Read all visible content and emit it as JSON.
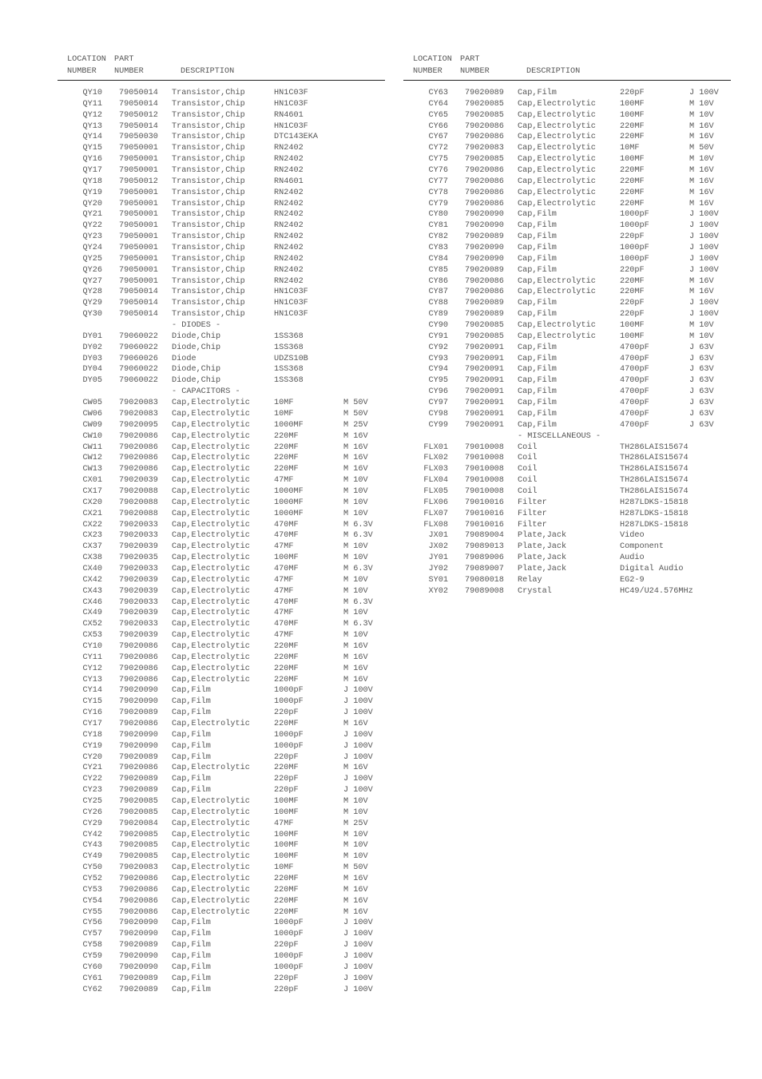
{
  "header": {
    "line1": [
      "LOCATION",
      "PART"
    ],
    "line2": [
      "NUMBER",
      "NUMBER",
      "DESCRIPTION"
    ]
  },
  "left_column": [
    {
      "loc": "QY10",
      "part": "79050014",
      "desc": "Transistor,Chip",
      "value": "HN1C03F",
      "rating": ""
    },
    {
      "loc": "QY11",
      "part": "79050014",
      "desc": "Transistor,Chip",
      "value": "HN1C03F",
      "rating": ""
    },
    {
      "loc": "QY12",
      "part": "79050012",
      "desc": "Transistor,Chip",
      "value": "RN4601",
      "rating": ""
    },
    {
      "loc": "QY13",
      "part": "79050014",
      "desc": "Transistor,Chip",
      "value": "HN1C03F",
      "rating": ""
    },
    {
      "loc": "QY14",
      "part": "79050030",
      "desc": "Transistor,Chip",
      "value": "DTC143EKA",
      "rating": ""
    },
    {
      "loc": "QY15",
      "part": "79050001",
      "desc": "Transistor,Chip",
      "value": "RN2402",
      "rating": ""
    },
    {
      "loc": "QY16",
      "part": "79050001",
      "desc": "Transistor,Chip",
      "value": "RN2402",
      "rating": ""
    },
    {
      "loc": "QY17",
      "part": "79050001",
      "desc": "Transistor,Chip",
      "value": "RN2402",
      "rating": ""
    },
    {
      "loc": "QY18",
      "part": "79050012",
      "desc": "Transistor,Chip",
      "value": "RN4601",
      "rating": ""
    },
    {
      "loc": "QY19",
      "part": "79050001",
      "desc": "Transistor,Chip",
      "value": "RN2402",
      "rating": ""
    },
    {
      "loc": "QY20",
      "part": "79050001",
      "desc": "Transistor,Chip",
      "value": "RN2402",
      "rating": ""
    },
    {
      "loc": "QY21",
      "part": "79050001",
      "desc": "Transistor,Chip",
      "value": "RN2402",
      "rating": ""
    },
    {
      "loc": "QY22",
      "part": "79050001",
      "desc": "Transistor,Chip",
      "value": "RN2402",
      "rating": ""
    },
    {
      "loc": "QY23",
      "part": "79050001",
      "desc": "Transistor,Chip",
      "value": "RN2402",
      "rating": ""
    },
    {
      "loc": "QY24",
      "part": "79050001",
      "desc": "Transistor,Chip",
      "value": "RN2402",
      "rating": ""
    },
    {
      "loc": "QY25",
      "part": "79050001",
      "desc": "Transistor,Chip",
      "value": "RN2402",
      "rating": ""
    },
    {
      "loc": "QY26",
      "part": "79050001",
      "desc": "Transistor,Chip",
      "value": "RN2402",
      "rating": ""
    },
    {
      "loc": "QY27",
      "part": "79050001",
      "desc": "Transistor,Chip",
      "value": "RN2402",
      "rating": ""
    },
    {
      "loc": "QY28",
      "part": "79050014",
      "desc": "Transistor,Chip",
      "value": "HN1C03F",
      "rating": ""
    },
    {
      "loc": "QY29",
      "part": "79050014",
      "desc": "Transistor,Chip",
      "value": "HN1C03F",
      "rating": ""
    },
    {
      "loc": "QY30",
      "part": "79050014",
      "desc": "Transistor,Chip",
      "value": "HN1C03F",
      "rating": ""
    },
    {
      "section": "- DIODES -"
    },
    {
      "loc": "DY01",
      "part": "79060022",
      "desc": "Diode,Chip",
      "value": "1SS368",
      "rating": ""
    },
    {
      "loc": "DY02",
      "part": "79060022",
      "desc": "Diode,Chip",
      "value": "1SS368",
      "rating": ""
    },
    {
      "loc": "DY03",
      "part": "79060026",
      "desc": "Diode",
      "value": "UDZS10B",
      "rating": ""
    },
    {
      "loc": "DY04",
      "part": "79060022",
      "desc": "Diode,Chip",
      "value": "1SS368",
      "rating": ""
    },
    {
      "loc": "DY05",
      "part": "79060022",
      "desc": "Diode,Chip",
      "value": "1SS368",
      "rating": ""
    },
    {
      "section": "- CAPACITORS -"
    },
    {
      "loc": "CW05",
      "part": "79020083",
      "desc": "Cap,Electrolytic",
      "value": "10MF",
      "rating": "M 50V"
    },
    {
      "loc": "CW06",
      "part": "79020083",
      "desc": "Cap,Electrolytic",
      "value": "10MF",
      "rating": "M 50V"
    },
    {
      "loc": "CW09",
      "part": "79020095",
      "desc": "Cap,Electrolytic",
      "value": "1000MF",
      "rating": "M 25V"
    },
    {
      "loc": "CW10",
      "part": "79020086",
      "desc": "Cap,Electrolytic",
      "value": "220MF",
      "rating": "M 16V"
    },
    {
      "loc": "CW11",
      "part": "79020086",
      "desc": "Cap,Electrolytic",
      "value": "220MF",
      "rating": "M 16V"
    },
    {
      "loc": "CW12",
      "part": "79020086",
      "desc": "Cap,Electrolytic",
      "value": "220MF",
      "rating": "M 16V"
    },
    {
      "loc": "CW13",
      "part": "79020086",
      "desc": "Cap,Electrolytic",
      "value": "220MF",
      "rating": "M 16V"
    },
    {
      "loc": "CX01",
      "part": "79020039",
      "desc": "Cap,Electrolytic",
      "value": "47MF",
      "rating": "M 10V"
    },
    {
      "loc": "CX17",
      "part": "79020088",
      "desc": "Cap,Electrolytic",
      "value": "1000MF",
      "rating": "M 10V"
    },
    {
      "loc": "CX20",
      "part": "79020088",
      "desc": "Cap,Electrolytic",
      "value": "1000MF",
      "rating": "M 10V"
    },
    {
      "loc": "CX21",
      "part": "79020088",
      "desc": "Cap,Electrolytic",
      "value": "1000MF",
      "rating": "M 10V"
    },
    {
      "loc": "CX22",
      "part": "79020033",
      "desc": "Cap,Electrolytic",
      "value": "470MF",
      "rating": "M 6.3V"
    },
    {
      "loc": "CX23",
      "part": "79020033",
      "desc": "Cap,Electrolytic",
      "value": "470MF",
      "rating": "M 6.3V"
    },
    {
      "loc": "CX37",
      "part": "79020039",
      "desc": "Cap,Electrolytic",
      "value": "47MF",
      "rating": "M 10V"
    },
    {
      "loc": "CX38",
      "part": "79020035",
      "desc": "Cap,Electrolytic",
      "value": "100MF",
      "rating": "M 10V"
    },
    {
      "loc": "CX40",
      "part": "79020033",
      "desc": "Cap,Electrolytic",
      "value": "470MF",
      "rating": "M 6.3V"
    },
    {
      "loc": "CX42",
      "part": "79020039",
      "desc": "Cap,Electrolytic",
      "value": "47MF",
      "rating": "M 10V"
    },
    {
      "loc": "CX43",
      "part": "79020039",
      "desc": "Cap,Electrolytic",
      "value": "47MF",
      "rating": "M 10V"
    },
    {
      "loc": "CX46",
      "part": "79020033",
      "desc": "Cap,Electrolytic",
      "value": "470MF",
      "rating": "M 6.3V"
    },
    {
      "loc": "CX49",
      "part": "79020039",
      "desc": "Cap,Electrolytic",
      "value": "47MF",
      "rating": "M 10V"
    },
    {
      "loc": "CX52",
      "part": "79020033",
      "desc": "Cap,Electrolytic",
      "value": "470MF",
      "rating": "M 6.3V"
    },
    {
      "loc": "CX53",
      "part": "79020039",
      "desc": "Cap,Electrolytic",
      "value": "47MF",
      "rating": "M 10V"
    },
    {
      "loc": "CY10",
      "part": "79020086",
      "desc": "Cap,Electrolytic",
      "value": "220MF",
      "rating": "M 16V"
    },
    {
      "loc": "CY11",
      "part": "79020086",
      "desc": "Cap,Electrolytic",
      "value": "220MF",
      "rating": "M 16V"
    },
    {
      "loc": "CY12",
      "part": "79020086",
      "desc": "Cap,Electrolytic",
      "value": "220MF",
      "rating": "M 16V"
    },
    {
      "loc": "CY13",
      "part": "79020086",
      "desc": "Cap,Electrolytic",
      "value": "220MF",
      "rating": "M 16V"
    },
    {
      "loc": "CY14",
      "part": "79020090",
      "desc": "Cap,Film",
      "value": "1000pF",
      "rating": "J 100V"
    },
    {
      "loc": "CY15",
      "part": "79020090",
      "desc": "Cap,Film",
      "value": "1000pF",
      "rating": "J 100V"
    },
    {
      "loc": "CY16",
      "part": "79020089",
      "desc": "Cap,Film",
      "value": "220pF",
      "rating": "J 100V"
    },
    {
      "loc": "CY17",
      "part": "79020086",
      "desc": "Cap,Electrolytic",
      "value": "220MF",
      "rating": "M 16V"
    },
    {
      "loc": "CY18",
      "part": "79020090",
      "desc": "Cap,Film",
      "value": "1000pF",
      "rating": "J 100V"
    },
    {
      "loc": "CY19",
      "part": "79020090",
      "desc": "Cap,Film",
      "value": "1000pF",
      "rating": "J 100V"
    },
    {
      "loc": "CY20",
      "part": "79020089",
      "desc": "Cap,Film",
      "value": "220pF",
      "rating": "J 100V"
    },
    {
      "loc": "CY21",
      "part": "79020086",
      "desc": "Cap,Electrolytic",
      "value": "220MF",
      "rating": "M 16V"
    },
    {
      "loc": "CY22",
      "part": "79020089",
      "desc": "Cap,Film",
      "value": "220pF",
      "rating": "J 100V"
    },
    {
      "loc": "CY23",
      "part": "79020089",
      "desc": "Cap,Film",
      "value": "220pF",
      "rating": "J 100V"
    },
    {
      "loc": "CY25",
      "part": "79020085",
      "desc": "Cap,Electrolytic",
      "value": "100MF",
      "rating": "M 10V"
    },
    {
      "loc": "CY26",
      "part": "79020085",
      "desc": "Cap,Electrolytic",
      "value": "100MF",
      "rating": "M 10V"
    },
    {
      "loc": "CY29",
      "part": "79020084",
      "desc": "Cap,Electrolytic",
      "value": "47MF",
      "rating": "M 25V"
    },
    {
      "loc": "CY42",
      "part": "79020085",
      "desc": "Cap,Electrolytic",
      "value": "100MF",
      "rating": "M 10V"
    },
    {
      "loc": "CY43",
      "part": "79020085",
      "desc": "Cap,Electrolytic",
      "value": "100MF",
      "rating": "M 10V"
    },
    {
      "loc": "CY49",
      "part": "79020085",
      "desc": "Cap,Electrolytic",
      "value": "100MF",
      "rating": "M 10V"
    },
    {
      "loc": "CY50",
      "part": "79020083",
      "desc": "Cap,Electrolytic",
      "value": "10MF",
      "rating": "M 50V"
    },
    {
      "loc": "CY52",
      "part": "79020086",
      "desc": "Cap,Electrolytic",
      "value": "220MF",
      "rating": "M 16V"
    },
    {
      "loc": "CY53",
      "part": "79020086",
      "desc": "Cap,Electrolytic",
      "value": "220MF",
      "rating": "M 16V"
    },
    {
      "loc": "CY54",
      "part": "79020086",
      "desc": "Cap,Electrolytic",
      "value": "220MF",
      "rating": "M 16V"
    },
    {
      "loc": "CY55",
      "part": "79020086",
      "desc": "Cap,Electrolytic",
      "value": "220MF",
      "rating": "M 16V"
    },
    {
      "loc": "CY56",
      "part": "79020090",
      "desc": "Cap,Film",
      "value": "1000pF",
      "rating": "J 100V"
    },
    {
      "loc": "CY57",
      "part": "79020090",
      "desc": "Cap,Film",
      "value": "1000pF",
      "rating": "J 100V"
    },
    {
      "loc": "CY58",
      "part": "79020089",
      "desc": "Cap,Film",
      "value": "220pF",
      "rating": "J 100V"
    },
    {
      "loc": "CY59",
      "part": "79020090",
      "desc": "Cap,Film",
      "value": "1000pF",
      "rating": "J 100V"
    },
    {
      "loc": "CY60",
      "part": "79020090",
      "desc": "Cap,Film",
      "value": "1000pF",
      "rating": "J 100V"
    },
    {
      "loc": "CY61",
      "part": "79020089",
      "desc": "Cap,Film",
      "value": "220pF",
      "rating": "J 100V"
    },
    {
      "loc": "CY62",
      "part": "79020089",
      "desc": "Cap,Film",
      "value": "220pF",
      "rating": "J 100V"
    }
  ],
  "right_column": [
    {
      "loc": "CY63",
      "part": "79020089",
      "desc": "Cap,Film",
      "value": "220pF",
      "rating": "J 100V"
    },
    {
      "loc": "CY64",
      "part": "79020085",
      "desc": "Cap,Electrolytic",
      "value": "100MF",
      "rating": "M 10V"
    },
    {
      "loc": "CY65",
      "part": "79020085",
      "desc": "Cap,Electrolytic",
      "value": "100MF",
      "rating": "M 10V"
    },
    {
      "loc": "CY66",
      "part": "79020086",
      "desc": "Cap,Electrolytic",
      "value": "220MF",
      "rating": "M 16V"
    },
    {
      "loc": "CY67",
      "part": "79020086",
      "desc": "Cap,Electrolytic",
      "value": "220MF",
      "rating": "M 16V"
    },
    {
      "loc": "CY72",
      "part": "79020083",
      "desc": "Cap,Electrolytic",
      "value": "10MF",
      "rating": "M 50V"
    },
    {
      "loc": "CY75",
      "part": "79020085",
      "desc": "Cap,Electrolytic",
      "value": "100MF",
      "rating": "M 10V"
    },
    {
      "loc": "CY76",
      "part": "79020086",
      "desc": "Cap,Electrolytic",
      "value": "220MF",
      "rating": "M 16V"
    },
    {
      "loc": "CY77",
      "part": "79020086",
      "desc": "Cap,Electrolytic",
      "value": "220MF",
      "rating": "M 16V"
    },
    {
      "loc": "CY78",
      "part": "79020086",
      "desc": "Cap,Electrolytic",
      "value": "220MF",
      "rating": "M 16V"
    },
    {
      "loc": "CY79",
      "part": "79020086",
      "desc": "Cap,Electrolytic",
      "value": "220MF",
      "rating": "M 16V"
    },
    {
      "loc": "CY80",
      "part": "79020090",
      "desc": "Cap,Film",
      "value": "1000pF",
      "rating": "J 100V"
    },
    {
      "loc": "CY81",
      "part": "79020090",
      "desc": "Cap,Film",
      "value": "1000pF",
      "rating": "J 100V"
    },
    {
      "loc": "CY82",
      "part": "79020089",
      "desc": "Cap,Film",
      "value": "220pF",
      "rating": "J 100V"
    },
    {
      "loc": "CY83",
      "part": "79020090",
      "desc": "Cap,Film",
      "value": "1000pF",
      "rating": "J 100V"
    },
    {
      "loc": "CY84",
      "part": "79020090",
      "desc": "Cap,Film",
      "value": "1000pF",
      "rating": "J 100V"
    },
    {
      "loc": "CY85",
      "part": "79020089",
      "desc": "Cap,Film",
      "value": "220pF",
      "rating": "J 100V"
    },
    {
      "loc": "CY86",
      "part": "79020086",
      "desc": "Cap,Electrolytic",
      "value": "220MF",
      "rating": "M 16V"
    },
    {
      "loc": "CY87",
      "part": "79020086",
      "desc": "Cap,Electrolytic",
      "value": "220MF",
      "rating": "M 16V"
    },
    {
      "loc": "CY88",
      "part": "79020089",
      "desc": "Cap,Film",
      "value": "220pF",
      "rating": "J 100V"
    },
    {
      "loc": "CY89",
      "part": "79020089",
      "desc": "Cap,Film",
      "value": "220pF",
      "rating": "J 100V"
    },
    {
      "loc": "CY90",
      "part": "79020085",
      "desc": "Cap,Electrolytic",
      "value": "100MF",
      "rating": "M 10V"
    },
    {
      "loc": "CY91",
      "part": "79020085",
      "desc": "Cap,Electrolytic",
      "value": "100MF",
      "rating": "M 10V"
    },
    {
      "loc": "CY92",
      "part": "79020091",
      "desc": "Cap,Film",
      "value": "4700pF",
      "rating": "J 63V"
    },
    {
      "loc": "CY93",
      "part": "79020091",
      "desc": "Cap,Film",
      "value": "4700pF",
      "rating": "J 63V"
    },
    {
      "loc": "CY94",
      "part": "79020091",
      "desc": "Cap,Film",
      "value": "4700pF",
      "rating": "J 63V"
    },
    {
      "loc": "CY95",
      "part": "79020091",
      "desc": "Cap,Film",
      "value": "4700pF",
      "rating": "J 63V"
    },
    {
      "loc": "CY96",
      "part": "79020091",
      "desc": "Cap,Film",
      "value": "4700pF",
      "rating": "J 63V"
    },
    {
      "loc": "CY97",
      "part": "79020091",
      "desc": "Cap,Film",
      "value": "4700pF",
      "rating": "J 63V"
    },
    {
      "loc": "CY98",
      "part": "79020091",
      "desc": "Cap,Film",
      "value": "4700pF",
      "rating": "J 63V"
    },
    {
      "loc": "CY99",
      "part": "79020091",
      "desc": "Cap,Film",
      "value": "4700pF",
      "rating": "J 63V"
    },
    {
      "section": "- MISCELLANEOUS -"
    },
    {
      "loc": "FLX01",
      "part": "79010008",
      "desc": "Coil",
      "value": "TH286LAIS15674",
      "rating": ""
    },
    {
      "loc": "FLX02",
      "part": "79010008",
      "desc": "Coil",
      "value": "TH286LAIS15674",
      "rating": ""
    },
    {
      "loc": "FLX03",
      "part": "79010008",
      "desc": "Coil",
      "value": "TH286LAIS15674",
      "rating": ""
    },
    {
      "loc": "FLX04",
      "part": "79010008",
      "desc": "Coil",
      "value": "TH286LAIS15674",
      "rating": ""
    },
    {
      "loc": "FLX05",
      "part": "79010008",
      "desc": "Coil",
      "value": "TH286LAIS15674",
      "rating": ""
    },
    {
      "loc": "FLX06",
      "part": "79010016",
      "desc": "Filter",
      "value": "H287LDKS-15818",
      "rating": ""
    },
    {
      "loc": "FLX07",
      "part": "79010016",
      "desc": "Filter",
      "value": "H287LDKS-15818",
      "rating": ""
    },
    {
      "loc": "FLX08",
      "part": "79010016",
      "desc": "Filter",
      "value": "H287LDKS-15818",
      "rating": ""
    },
    {
      "loc": "JX01",
      "part": "79089004",
      "desc": "Plate,Jack",
      "value": "Video",
      "rating": ""
    },
    {
      "loc": "JX02",
      "part": "79089013",
      "desc": "Plate,Jack",
      "value": "Component",
      "rating": ""
    },
    {
      "loc": "JY01",
      "part": "79089006",
      "desc": "Plate,Jack",
      "value": "Audio",
      "rating": ""
    },
    {
      "loc": "JY02",
      "part": "79089007",
      "desc": "Plate,Jack",
      "value": "Digital Audio",
      "rating": ""
    },
    {
      "loc": "SY01",
      "part": "79080018",
      "desc": "Relay",
      "value": "EG2-9",
      "rating": ""
    },
    {
      "loc": "XY02",
      "part": "79089008",
      "desc": "Crystal",
      "value": "HC49/U24.576MHz",
      "rating": ""
    }
  ]
}
